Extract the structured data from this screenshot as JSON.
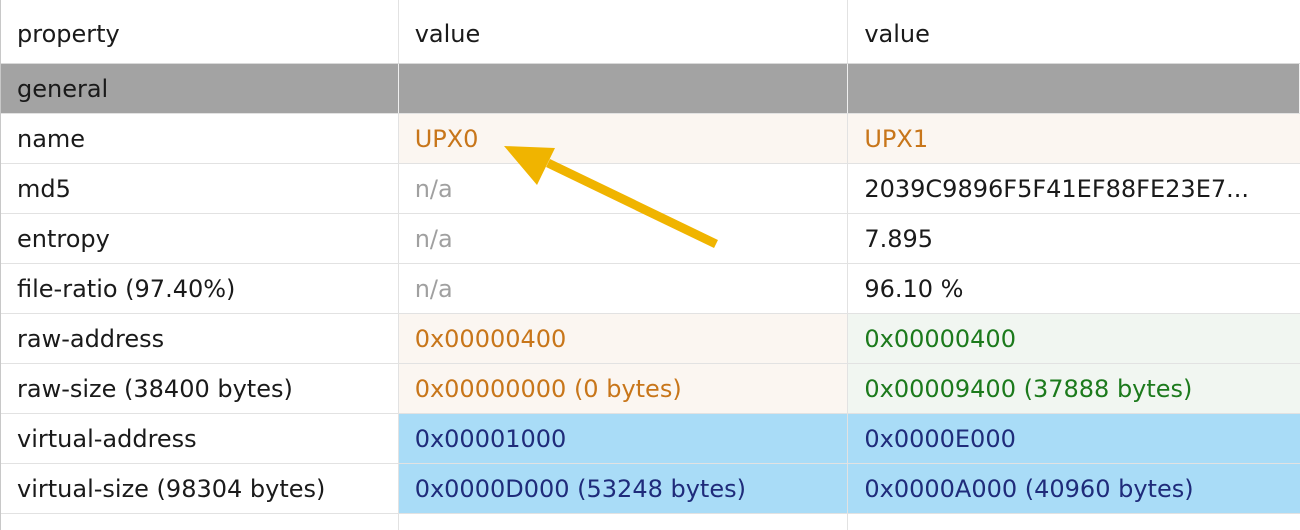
{
  "header": {
    "property": "property",
    "value1": "value",
    "value2": "value"
  },
  "section": {
    "label": "general"
  },
  "rows": [
    {
      "property": "name",
      "v1": "UPX0",
      "v2": "UPX1"
    },
    {
      "property": "md5",
      "v1": "n/a",
      "v2": "2039C9896F5F41EF88FE23E7..."
    },
    {
      "property": "entropy",
      "v1": "n/a",
      "v2": "7.895"
    },
    {
      "property": "file-ratio (97.40%)",
      "v1": "n/a",
      "v2": "96.10 %"
    },
    {
      "property": "raw-address",
      "v1": "0x00000400",
      "v2": "0x00000400"
    },
    {
      "property": "raw-size (38400 bytes)",
      "v1": "0x00000000 (0 bytes)",
      "v2": "0x00009400 (37888 bytes)"
    },
    {
      "property": "virtual-address",
      "v1": "0x00001000",
      "v2": "0x0000E000"
    },
    {
      "property": "virtual-size (98304 bytes)",
      "v1": "0x0000D000 (53248 bytes)",
      "v2": "0x0000A000 (40960 bytes)"
    }
  ],
  "colors": {
    "orange_text": "#c8761a",
    "green_text": "#1c7a1c",
    "navy_text": "#1f2b7a",
    "section_bg": "#a3a3a3",
    "highlight_blue": "#a9dcf7",
    "arrow": "#f0b400"
  },
  "annotation": {
    "icon": "arrow-icon"
  }
}
